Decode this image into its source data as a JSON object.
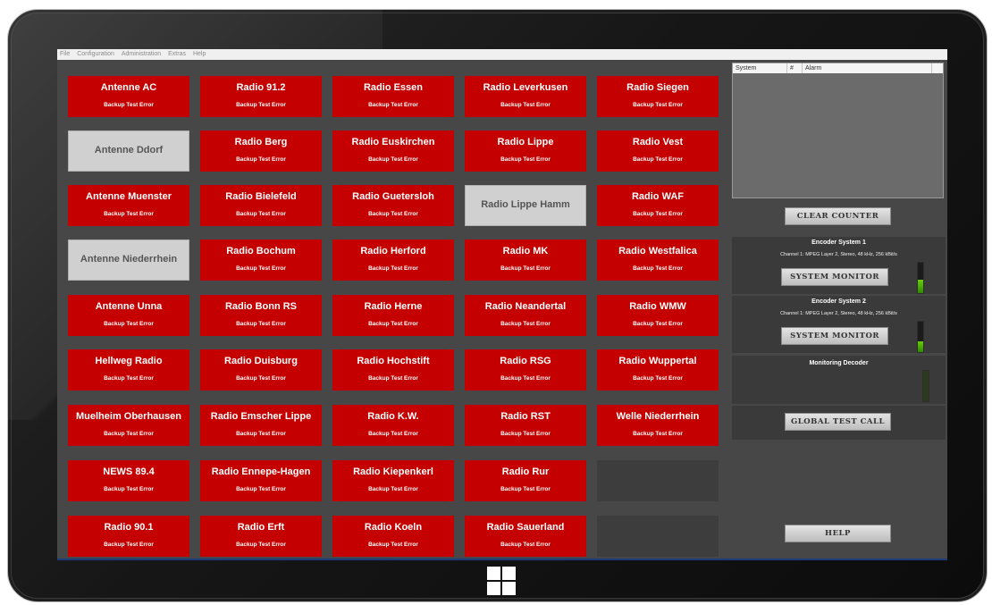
{
  "menu": [
    "File",
    "Configuration",
    "Administration",
    "Extras",
    "Help"
  ],
  "tile_status": "Backup Test Error",
  "columns": [
    {
      "tiles": [
        {
          "name": "Antenne AC",
          "state": "error"
        },
        {
          "name": "Antenne Ddorf",
          "state": "ok"
        },
        {
          "name": "Antenne Muenster",
          "state": "error"
        },
        {
          "name": "Antenne Niederrhein",
          "state": "ok"
        },
        {
          "name": "Antenne Unna",
          "state": "error"
        },
        {
          "name": "Hellweg Radio",
          "state": "error"
        },
        {
          "name": "Muelheim Oberhausen",
          "state": "error"
        },
        {
          "name": "NEWS 89.4",
          "state": "error"
        },
        {
          "name": "Radio 90.1",
          "state": "error"
        }
      ]
    },
    {
      "tiles": [
        {
          "name": "Radio 91.2",
          "state": "error"
        },
        {
          "name": "Radio Berg",
          "state": "error"
        },
        {
          "name": "Radio Bielefeld",
          "state": "error"
        },
        {
          "name": "Radio Bochum",
          "state": "error"
        },
        {
          "name": "Radio Bonn RS",
          "state": "error"
        },
        {
          "name": "Radio Duisburg",
          "state": "error"
        },
        {
          "name": "Radio Emscher Lippe",
          "state": "error"
        },
        {
          "name": "Radio Ennepe-Hagen",
          "state": "error"
        },
        {
          "name": "Radio Erft",
          "state": "error"
        }
      ]
    },
    {
      "tiles": [
        {
          "name": "Radio Essen",
          "state": "error"
        },
        {
          "name": "Radio Euskirchen",
          "state": "error"
        },
        {
          "name": "Radio Guetersloh",
          "state": "error"
        },
        {
          "name": "Radio Herford",
          "state": "error"
        },
        {
          "name": "Radio Herne",
          "state": "error"
        },
        {
          "name": "Radio Hochstift",
          "state": "error"
        },
        {
          "name": "Radio K.W.",
          "state": "error"
        },
        {
          "name": "Radio Kiepenkerl",
          "state": "error"
        },
        {
          "name": "Radio Koeln",
          "state": "error"
        }
      ]
    },
    {
      "tiles": [
        {
          "name": "Radio Leverkusen",
          "state": "error"
        },
        {
          "name": "Radio Lippe",
          "state": "error"
        },
        {
          "name": "Radio Lippe Hamm",
          "state": "ok"
        },
        {
          "name": "Radio MK",
          "state": "error"
        },
        {
          "name": "Radio Neandertal",
          "state": "error"
        },
        {
          "name": "Radio RSG",
          "state": "error"
        },
        {
          "name": "Radio RST",
          "state": "error"
        },
        {
          "name": "Radio Rur",
          "state": "error"
        },
        {
          "name": "Radio Sauerland",
          "state": "error"
        }
      ]
    },
    {
      "tiles": [
        {
          "name": "Radio Siegen",
          "state": "error"
        },
        {
          "name": "Radio Vest",
          "state": "error"
        },
        {
          "name": "Radio WAF",
          "state": "error"
        },
        {
          "name": "Radio Westfalica",
          "state": "error"
        },
        {
          "name": "Radio WMW",
          "state": "error"
        },
        {
          "name": "Radio Wuppertal",
          "state": "error"
        },
        {
          "name": "Welle Niederrhein",
          "state": "error"
        },
        {
          "name": "",
          "state": "empty"
        },
        {
          "name": "",
          "state": "empty"
        }
      ]
    }
  ],
  "alarm_table": {
    "columns": [
      "System",
      "#",
      "Alarm"
    ],
    "rows": []
  },
  "buttons": {
    "clear_counter": "CLEAR COUNTER",
    "system_monitor": "SYSTEM MONITOR",
    "global_test_call": "GLOBAL TEST CALL",
    "help": "HELP"
  },
  "encoder1": {
    "title": "Encoder System 1",
    "channel": "Channel 1: MPEG Layer 2, Stereo, 48 kHz, 256 kBit/s",
    "level": 0.45
  },
  "encoder2": {
    "title": "Encoder System 2",
    "channel": "Channel 1: MPEG Layer 2, Stereo, 48 kHz, 256 kBit/s",
    "level": 0.35
  },
  "monitoring_decoder": {
    "title": "Monitoring Decoder",
    "level": 0
  },
  "colors": {
    "error": "#c40000",
    "ok": "#d0d0d0",
    "screen_bg": "#474747"
  }
}
